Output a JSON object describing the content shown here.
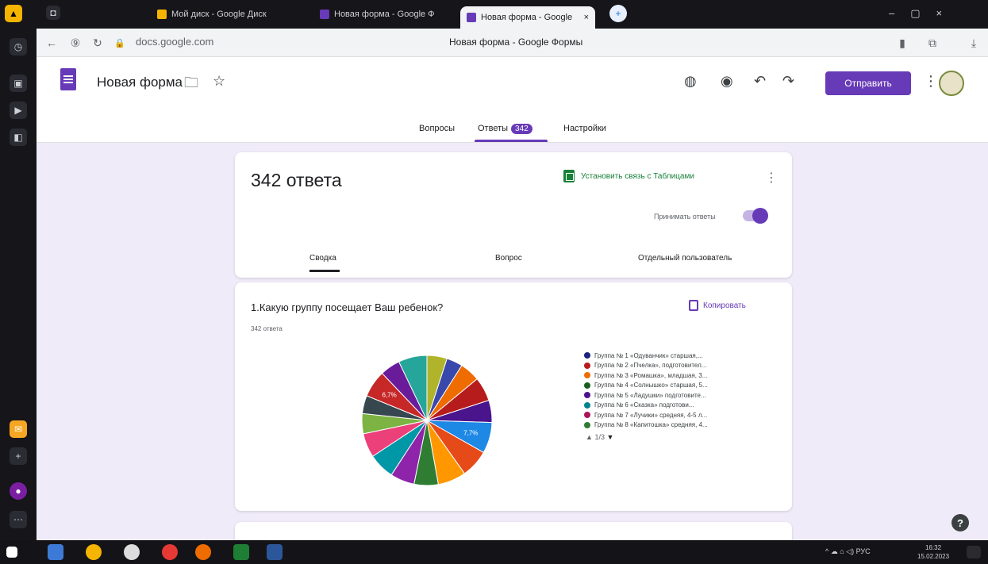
{
  "browser": {
    "tabs": [
      {
        "label": "Мой диск - Google Диск",
        "active": false,
        "color": "#f4b400"
      },
      {
        "label": "Новая форма - Google Ф",
        "active": false,
        "color": "#673ab7"
      },
      {
        "label": "Новая форма - Google",
        "active": true,
        "color": "#673ab7"
      }
    ],
    "url": "docs.google.com",
    "page_title": "Новая форма - Google Формы"
  },
  "forms_header": {
    "form_title": "Новая форма",
    "send_label": "Отправить",
    "tabs": {
      "questions": "Вопросы",
      "responses": "Ответы",
      "responses_badge": "342",
      "settings": "Настройки"
    }
  },
  "summary_card": {
    "count_label": "342 ответа",
    "sheets_link": "Установить связь с Таблицами",
    "accept_label": "Принимать ответы",
    "subtabs": {
      "summary": "Сводка",
      "question": "Вопрос",
      "individual": "Отдельный пользователь"
    }
  },
  "question_card": {
    "title": "1.Какую группу посещает Ваш ребенок?",
    "count": "342 ответа",
    "copy_label": "Копировать",
    "pager": "1/3"
  },
  "chart_data": {
    "type": "pie",
    "legend": [
      {
        "label": "Группа № 1 «Одуванчик» старшая,...",
        "color": "#1a237e"
      },
      {
        "label": "Группа № 2 «Пчелка», подготовител...",
        "color": "#b71c1c"
      },
      {
        "label": "Группа № 3 «Ромашка», младшая, 3...",
        "color": "#ef6c00"
      },
      {
        "label": "Группа № 4 «Солнышко» старшая, 5...",
        "color": "#1b5e20"
      },
      {
        "label": "Группа № 5 «Ладушки» подготовите...",
        "color": "#4a148c"
      },
      {
        "label": "Группа № 6 «Сказка» подготови...",
        "color": "#00838f"
      },
      {
        "label": "Группа № 7 «Лучики» средняя, 4-5 л...",
        "color": "#ad1457"
      },
      {
        "label": "Группа № 8 «Капитошка» средняя, 4...",
        "color": "#2e7d32"
      }
    ],
    "slices": [
      {
        "value": 5.0,
        "color": "#afb42b"
      },
      {
        "value": 4.0,
        "color": "#3949ab"
      },
      {
        "value": 5.0,
        "color": "#ef6c00"
      },
      {
        "value": 6.0,
        "color": "#b71c1c"
      },
      {
        "value": 5.5,
        "color": "#4a148c"
      },
      {
        "value": 7.7,
        "color": "#1e88e5",
        "label": "7,7%"
      },
      {
        "value": 7.0,
        "color": "#e64a19"
      },
      {
        "value": 7.0,
        "color": "#ff9800"
      },
      {
        "value": 6.0,
        "color": "#2e7d32"
      },
      {
        "value": 6.0,
        "color": "#8e24aa"
      },
      {
        "value": 6.5,
        "color": "#0097a7"
      },
      {
        "value": 6.0,
        "color": "#ec407a"
      },
      {
        "value": 5.0,
        "color": "#7cb342"
      },
      {
        "value": 4.5,
        "color": "#37474f"
      },
      {
        "value": 6.7,
        "color": "#c62828",
        "label": "6,7%"
      },
      {
        "value": 5.0,
        "color": "#6a1b9a"
      },
      {
        "value": 7.1,
        "color": "#26a69a"
      }
    ]
  },
  "taskbar": {
    "lang": "РУС",
    "time": "16:32",
    "date": "15.02.2023"
  }
}
